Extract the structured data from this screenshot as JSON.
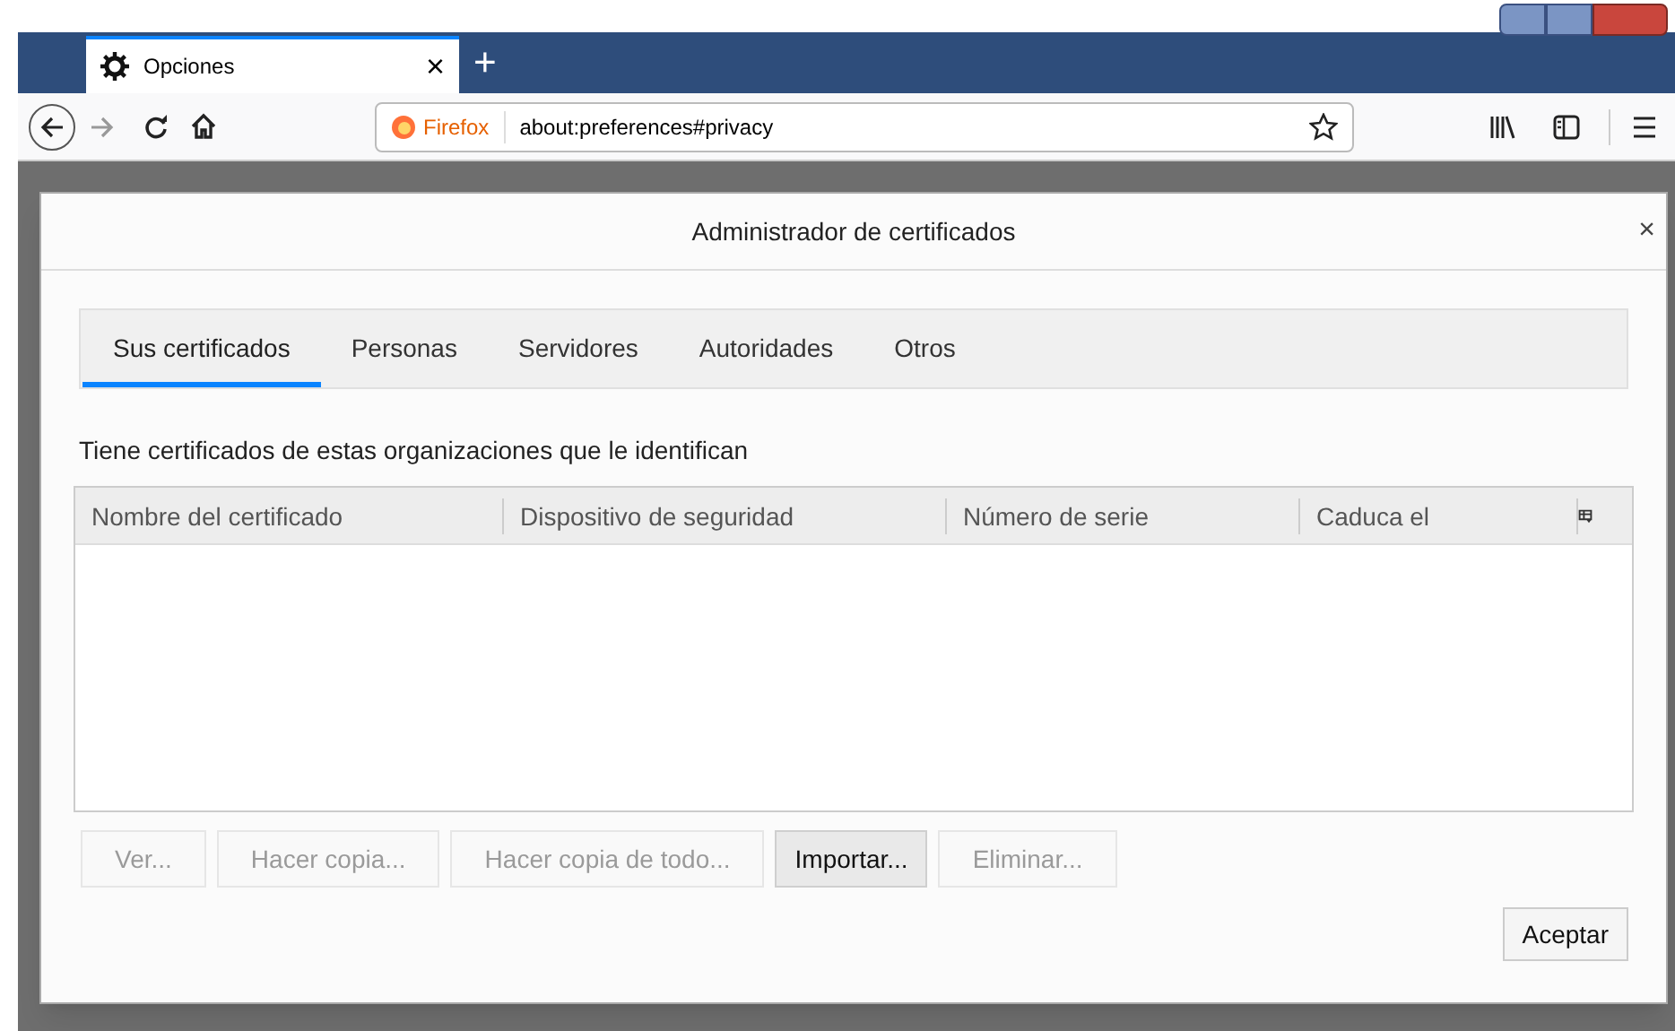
{
  "browser": {
    "tab": {
      "title": "Opciones",
      "close": "×"
    },
    "new_tab": "+",
    "identity": "Firefox",
    "url": "about:preferences#privacy"
  },
  "dialog": {
    "title": "Administrador de certificados",
    "close": "×",
    "tabs": [
      {
        "label": "Sus certificados",
        "selected": true
      },
      {
        "label": "Personas",
        "selected": false
      },
      {
        "label": "Servidores",
        "selected": false
      },
      {
        "label": "Autoridades",
        "selected": false
      },
      {
        "label": "Otros",
        "selected": false
      }
    ],
    "description": "Tiene certificados de estas organizaciones que le identifican",
    "table": {
      "columns": [
        "Nombre del certificado",
        "Dispositivo de seguridad",
        "Número de serie",
        "Caduca el"
      ]
    },
    "buttons": [
      {
        "label": "Ver...",
        "disabled": true
      },
      {
        "label": "Hacer copia...",
        "disabled": true
      },
      {
        "label": "Hacer copia de todo...",
        "disabled": true
      },
      {
        "label": "Importar...",
        "disabled": false
      },
      {
        "label": "Eliminar...",
        "disabled": true
      }
    ],
    "accept": "Aceptar"
  }
}
